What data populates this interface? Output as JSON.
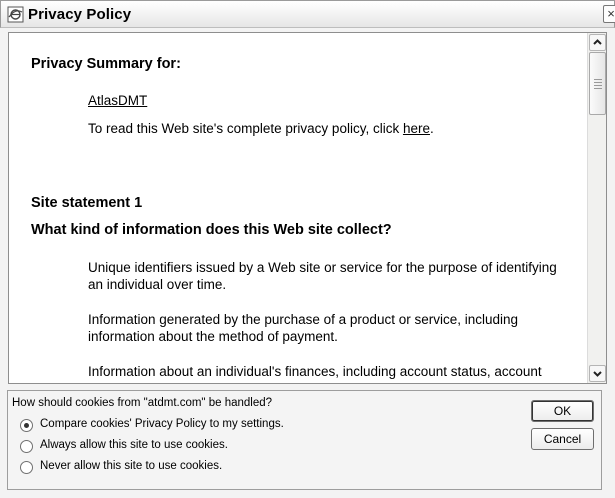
{
  "window": {
    "title": "Privacy Policy",
    "close_glyph": "×",
    "title_icon": "ie-globe-icon"
  },
  "content": {
    "summary_heading": "Privacy Summary for:",
    "site_name": "AtlasDMT",
    "read_text": "To read this Web site's complete privacy policy, click ",
    "read_link": "here",
    "read_end": ".",
    "statement_heading": "Site statement 1",
    "question_heading": "What kind of information does this Web site collect?",
    "paragraphs": [
      "Unique identifiers issued by a Web site or service for the purpose of identifying an individual over time.",
      "Information generated by the purchase of a product or service, including information about the method of payment.",
      "Information about an individual's finances, including account status, account"
    ]
  },
  "cookies": {
    "question": "How should cookies from \"atdmt.com\" be handled?",
    "options": [
      {
        "label": "Compare cookies' Privacy Policy to my settings.",
        "selected": true
      },
      {
        "label": "Always allow this site to use cookies.",
        "selected": false
      },
      {
        "label": "Never allow this site to use cookies.",
        "selected": false
      }
    ]
  },
  "buttons": {
    "ok": "OK",
    "cancel": "Cancel"
  }
}
